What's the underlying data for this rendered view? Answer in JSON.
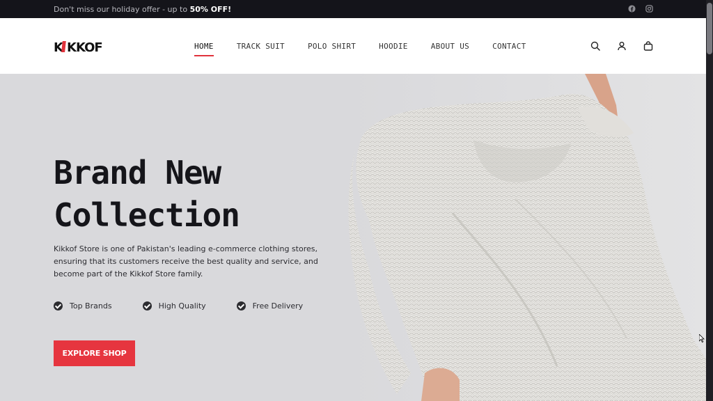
{
  "topbar": {
    "offer_prefix": "Don't miss our holiday offer - up to ",
    "offer_highlight": "50% OFF!",
    "social": [
      "facebook-icon",
      "instagram-icon"
    ]
  },
  "header": {
    "logo": "KIKKOF",
    "nav": [
      "HOME",
      "TRACK SUIT",
      "POLO SHIRT",
      "HOODIE",
      "ABOUT US",
      "CONTACT"
    ],
    "active_nav": "HOME",
    "icons": [
      "search-icon",
      "user-icon",
      "shopping-bag-icon"
    ]
  },
  "hero": {
    "title_line1": "Brand New",
    "title_line2": "Collection",
    "description": "Kikkof Store is one of Pakistan's leading e-commerce clothing stores, ensuring that its customers receive the best quality and service, and become part of the Kikkof Store family.",
    "features": [
      "Top Brands",
      "High Quality",
      "Free Delivery"
    ],
    "cta": "EXPLORE SHOP"
  },
  "colors": {
    "accent": "#e6353f",
    "topbar_bg": "#14141a",
    "hero_bg": "#d9d9dc"
  }
}
